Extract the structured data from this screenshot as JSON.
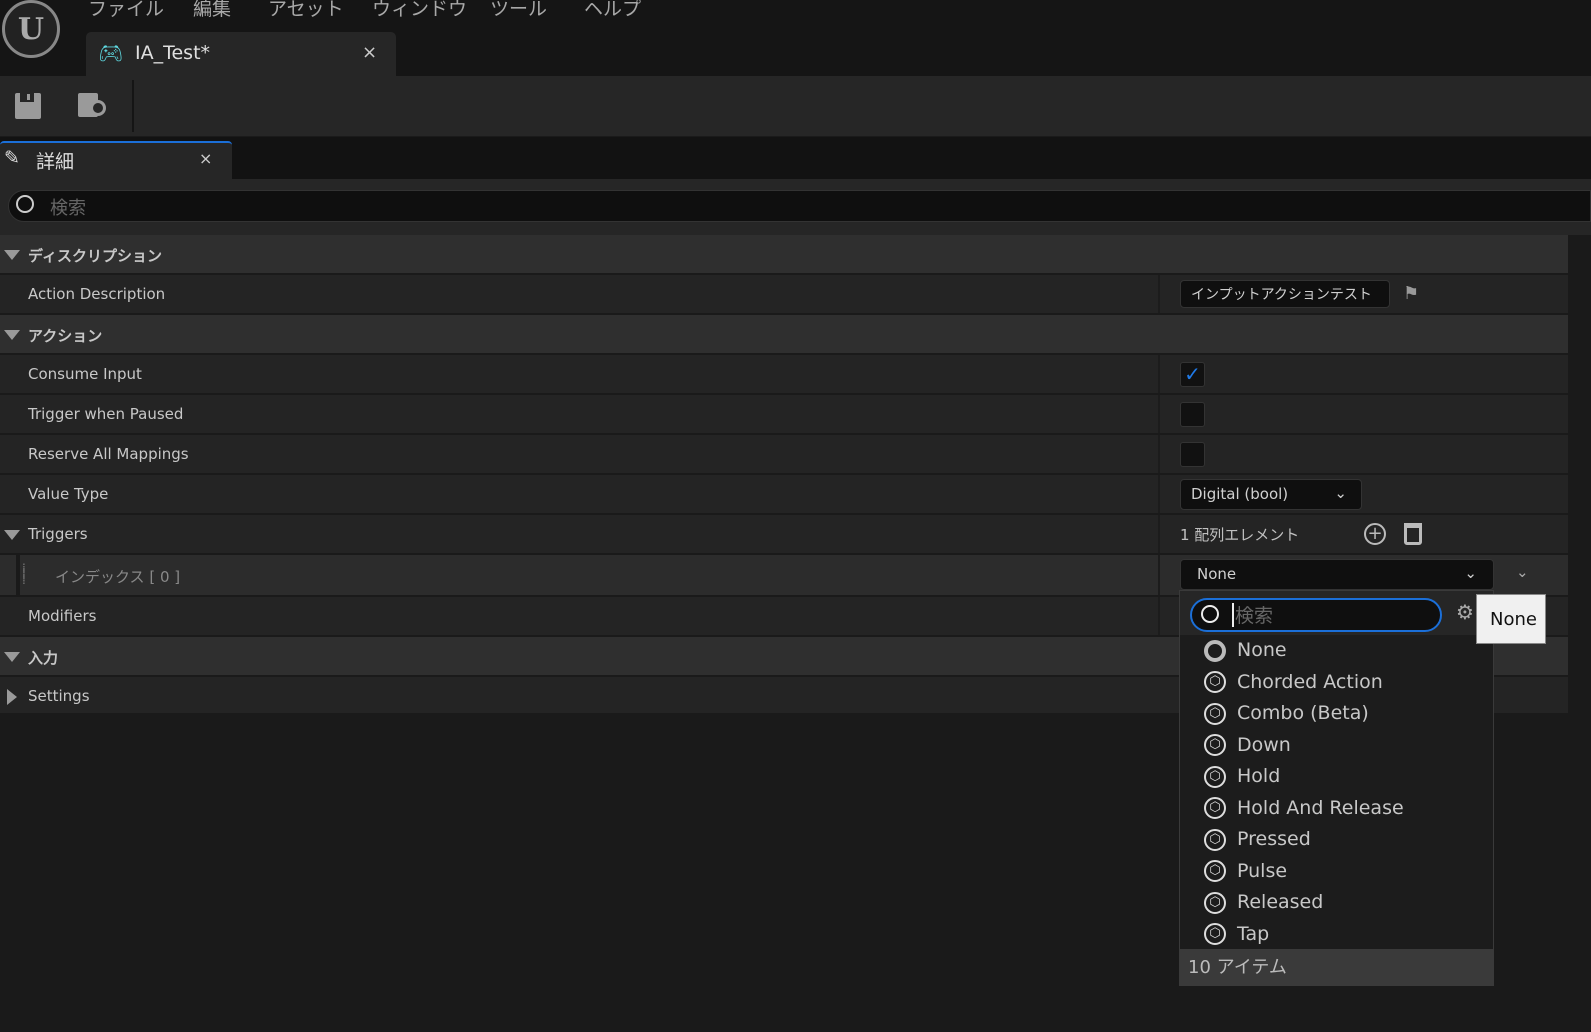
{
  "menu": [
    "ファイル",
    "編集",
    "アセット",
    "ウィンドウ",
    "ツール",
    "ヘルプ"
  ],
  "tab": {
    "title": "IA_Test*",
    "close": "×"
  },
  "details": {
    "title": "詳細",
    "close": "×",
    "search_placeholder": "検索"
  },
  "categories": {
    "description": "ディスクリプション",
    "action": "アクション",
    "input": "入力"
  },
  "props": {
    "action_description": {
      "label": "Action Description",
      "value": "インプットアクションテスト"
    },
    "consume_input": {
      "label": "Consume Input",
      "checked": true,
      "mark": "✓"
    },
    "trigger_when_paused": {
      "label": "Trigger when Paused",
      "checked": false
    },
    "reserve_all_mappings": {
      "label": "Reserve All Mappings",
      "checked": false
    },
    "value_type": {
      "label": "Value Type",
      "value": "Digital (bool)"
    },
    "triggers": {
      "label": "Triggers",
      "count": "1 配列エレメント",
      "index_label": "インデックス [ 0 ]",
      "value": "None"
    },
    "modifiers": {
      "label": "Modifiers"
    },
    "settings": {
      "label": "Settings"
    }
  },
  "dropdown": {
    "search_placeholder": "検索",
    "items": [
      "None",
      "Chorded Action",
      "Combo (Beta)",
      "Down",
      "Hold",
      "Hold And Release",
      "Pressed",
      "Pulse",
      "Released",
      "Tap"
    ],
    "footer": "10 アイテム",
    "tooltip": "None"
  },
  "colors": {
    "accent": "#1f7ae8",
    "tab_icon": "#5fd8e0"
  }
}
